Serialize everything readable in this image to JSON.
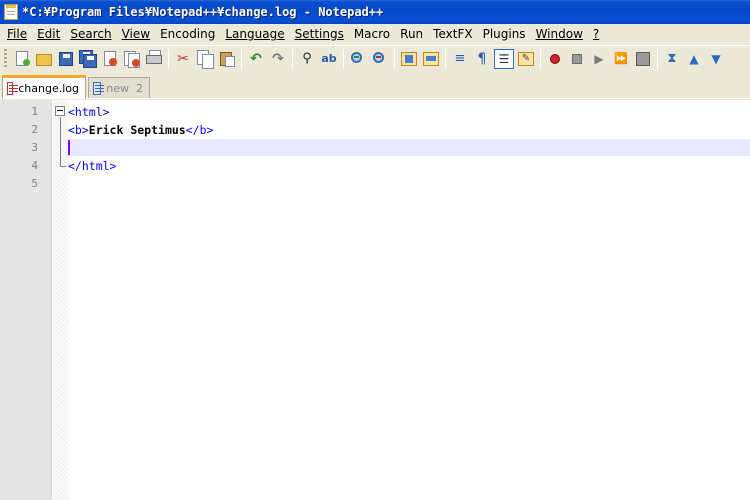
{
  "window": {
    "title": "*C:¥Program Files¥Notepad++¥change.log - Notepad++",
    "title_bar_color": "#0a50d6"
  },
  "menu": {
    "items": [
      {
        "label": "File"
      },
      {
        "label": "Edit"
      },
      {
        "label": "Search"
      },
      {
        "label": "View"
      },
      {
        "label": "Encoding"
      },
      {
        "label": "Language"
      },
      {
        "label": "Settings"
      },
      {
        "label": "Macro"
      },
      {
        "label": "Run"
      },
      {
        "label": "TextFX"
      },
      {
        "label": "Plugins"
      },
      {
        "label": "Window"
      },
      {
        "label": "?"
      }
    ]
  },
  "toolbar": {
    "icons": [
      "new-file-icon",
      "open-file-icon",
      "save-icon",
      "save-all-icon",
      "close-icon",
      "close-all-icon",
      "print-icon",
      "cut-icon",
      "copy-icon",
      "paste-icon",
      "undo-icon",
      "redo-icon",
      "find-icon",
      "replace-icon",
      "zoom-in-icon",
      "zoom-out-icon",
      "sync-vertical-icon",
      "sync-horizontal-icon",
      "word-wrap-icon",
      "show-all-chars-icon",
      "indent-guide-icon",
      "user-lang-icon",
      "record-macro-icon",
      "stop-macro-icon",
      "play-macro-icon",
      "run-macro-multiple-icon",
      "save-macro-icon",
      "fold-all-icon",
      "move-up-icon",
      "move-down-icon"
    ]
  },
  "tabs": [
    {
      "label": "change.log",
      "active": true,
      "modified": true
    },
    {
      "label": "new  2",
      "active": false,
      "modified": false
    }
  ],
  "editor": {
    "lines": [
      {
        "num": "1",
        "text": "<html>"
      },
      {
        "num": "2",
        "text_open": "<b>",
        "text_bold": "Erick Septimus",
        "text_close": "</b>"
      },
      {
        "num": "3",
        "text": ""
      },
      {
        "num": "4",
        "text": "</html>"
      },
      {
        "num": "5",
        "text": ""
      }
    ],
    "current_line": 3,
    "colors": {
      "tag": "#0000ff",
      "current_line_bg": "#e8e8ff",
      "caret": "#8000ff"
    }
  }
}
